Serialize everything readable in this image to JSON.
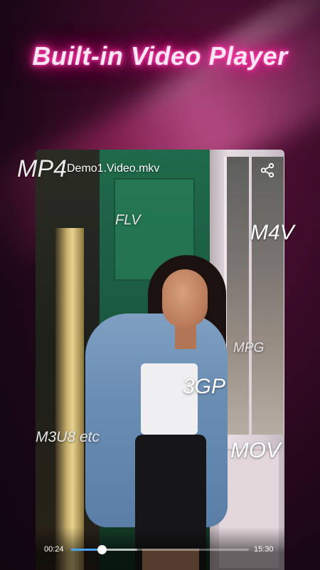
{
  "promo": {
    "headline": "Built-in Video Player"
  },
  "player": {
    "file_title": "Demo1.Video.mkv",
    "current_time": "00:24",
    "total_time": "15:30",
    "progress": 0.17,
    "buffered": 0.37
  },
  "formats": {
    "mp4": "MP4",
    "flv": "FLV",
    "m4v": "M4V",
    "mpg": "MPG",
    "gp3": "3GP",
    "m3u8": "M3U8 etc",
    "mov": "MOV"
  },
  "icons": {
    "share": "share-icon"
  },
  "colors": {
    "neon": "#ff2aa0",
    "progress": "#4aa3ff"
  }
}
